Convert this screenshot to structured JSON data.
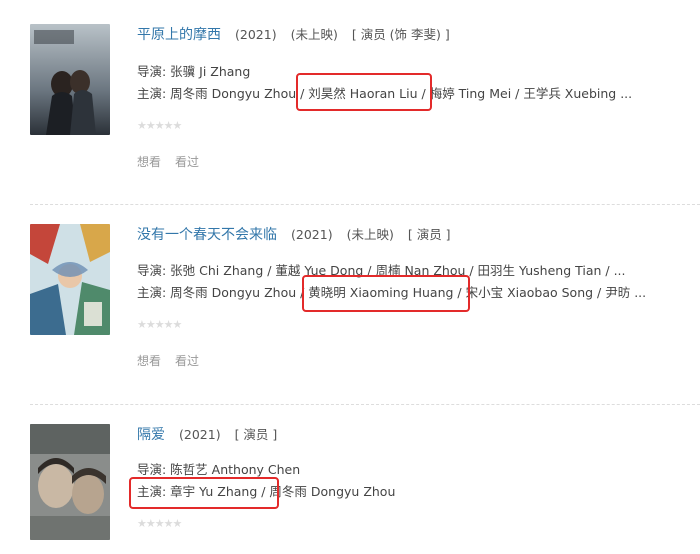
{
  "movies": [
    {
      "title": "平原上的摩西",
      "year": "(2021)",
      "status": "(未上映)",
      "role": "[ 演员 (饰 李斐) ]",
      "director": "导演: 张骥 Ji Zhang",
      "cast": "主演: 周冬雨 Dongyu Zhou / 刘昊然 Haoran Liu / 梅婷 Ting Mei / 王学兵 Xuebing ...",
      "want": "想看",
      "seen": "看过"
    },
    {
      "title": "没有一个春天不会来临",
      "year": "(2021)",
      "status": "(未上映)",
      "role": "[ 演员 ]",
      "director": "导演: 张弛 Chi Zhang / 董越 Yue Dong / 周楠 Nan Zhou / 田羽生 Yusheng Tian / ...",
      "cast": "主演: 周冬雨 Dongyu Zhou / 黄晓明 Xiaoming Huang / 宋小宝 Xiaobao Song / 尹昉 ...",
      "want": "想看",
      "seen": "看过"
    },
    {
      "title": "隔爱",
      "year": "(2021)",
      "role": "[ 演员 ]",
      "director": "导演: 陈哲艺 Anthony Chen",
      "cast": "主演: 章宇 Yu Zhang / 周冬雨 Dongyu Zhou"
    }
  ],
  "stars_glyphs": "★★★★★",
  "colors": {
    "link": "#3377aa",
    "highlight": "#e32a2a",
    "muted": "#999999"
  }
}
